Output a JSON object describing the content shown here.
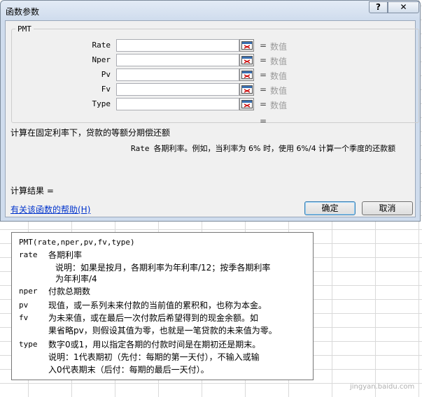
{
  "window": {
    "title": "函数参数",
    "help_button": "?",
    "close_button": "✕"
  },
  "function": {
    "name": "PMT",
    "args": [
      {
        "label": "Rate",
        "value": "",
        "eq": "=",
        "result": "数值"
      },
      {
        "label": "Nper",
        "value": "",
        "eq": "=",
        "result": "数值"
      },
      {
        "label": "Pv",
        "value": "",
        "eq": "=",
        "result": "数值"
      },
      {
        "label": "Fv",
        "value": "",
        "eq": "=",
        "result": "数值"
      },
      {
        "label": "Type",
        "value": "",
        "eq": "=",
        "result": "数值"
      }
    ],
    "result_eq": "=",
    "description": "计算在固定利率下，贷款的等额分期偿还额",
    "arg_desc_name": "Rate",
    "arg_desc_text": "各期利率。例如，当利率为 6% 时，使用 6%/4 计算一个季度的还款额",
    "calc_result": "计算结果 =",
    "help_link": "有关该函数的帮助(H)",
    "ok": "确定",
    "cancel": "取消"
  },
  "tooltip": {
    "signature": "PMT(rate,nper,pv,fv,type)",
    "rows": [
      {
        "name": "rate",
        "text": "各期利率"
      },
      {
        "name": "",
        "text": "说明：如果是按月，各期利率为年利率/12；按季各期利率"
      },
      {
        "name": "",
        "text": "为年利率/4"
      },
      {
        "name": "nper",
        "text": "付款总期数"
      },
      {
        "name": "pv",
        "text": "现值，或一系列未来付款的当前值的累积和，也称为本金。"
      },
      {
        "name": "fv",
        "text": "为未来值，或在最后一次付款后希望得到的现金余额。如"
      },
      {
        "name": "",
        "text": "果省略pv，则假设其值为零，也就是一笔贷款的未来值为零。"
      },
      {
        "name": "type",
        "text": "数字0或1，用以指定各期的付款时间是在期初还是期末。"
      },
      {
        "name": "",
        "text": "说明：1代表期初（先付：每期的第一天付），不输入或输"
      },
      {
        "name": "",
        "text": "入0代表期末（后付：每期的最后一天付）。"
      }
    ]
  },
  "watermark": "jingyan.baidu.com"
}
